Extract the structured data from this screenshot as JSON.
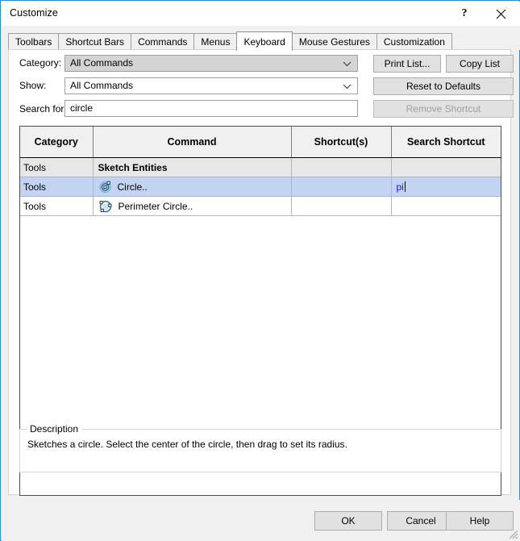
{
  "window": {
    "title": "Customize",
    "help_icon": "question-mark-icon",
    "close_icon": "close-icon"
  },
  "tabs": [
    {
      "label": "Toolbars",
      "active": false
    },
    {
      "label": "Shortcut Bars",
      "active": false
    },
    {
      "label": "Commands",
      "active": false
    },
    {
      "label": "Menus",
      "active": false
    },
    {
      "label": "Keyboard",
      "active": true
    },
    {
      "label": "Mouse Gestures",
      "active": false
    },
    {
      "label": "Customization",
      "active": false
    }
  ],
  "form": {
    "category_label": "Category:",
    "category_value": "All Commands",
    "show_label": "Show:",
    "show_value": "All Commands",
    "search_label": "Search for:",
    "search_value": "circle",
    "search_placeholder": ""
  },
  "buttons": {
    "print_list": "Print List...",
    "copy_list": "Copy List",
    "reset_defaults": "Reset to Defaults",
    "remove_shortcut": "Remove Shortcut"
  },
  "grid": {
    "columns": [
      "Category",
      "Command",
      "Shortcut(s)",
      "Search Shortcut"
    ],
    "rows": [
      {
        "kind": "group",
        "category": "Tools",
        "command": "Sketch Entities",
        "icon": "",
        "shortcuts": "",
        "search_shortcut": "",
        "selected": false
      },
      {
        "kind": "item",
        "category": "Tools",
        "command": "Circle..",
        "icon": "circle-sketch-icon",
        "shortcuts": "",
        "search_shortcut": "pi",
        "selected": true
      },
      {
        "kind": "item",
        "category": "Tools",
        "command": "Perimeter Circle..",
        "icon": "perimeter-circle-sketch-icon",
        "shortcuts": "",
        "search_shortcut": "",
        "selected": false
      }
    ]
  },
  "description": {
    "legend": "Description",
    "text": "Sketches a circle. Select the center of the circle, then drag to set its radius."
  },
  "footer": {
    "ok": "OK",
    "cancel": "Cancel",
    "help": "Help"
  },
  "colors": {
    "window_border": "#2f8ed6",
    "selection": "#c3d4f2",
    "group_row": "#e7e7e7",
    "shortcut_text": "#1119d6",
    "disabled_text": "#a0a0a0"
  }
}
